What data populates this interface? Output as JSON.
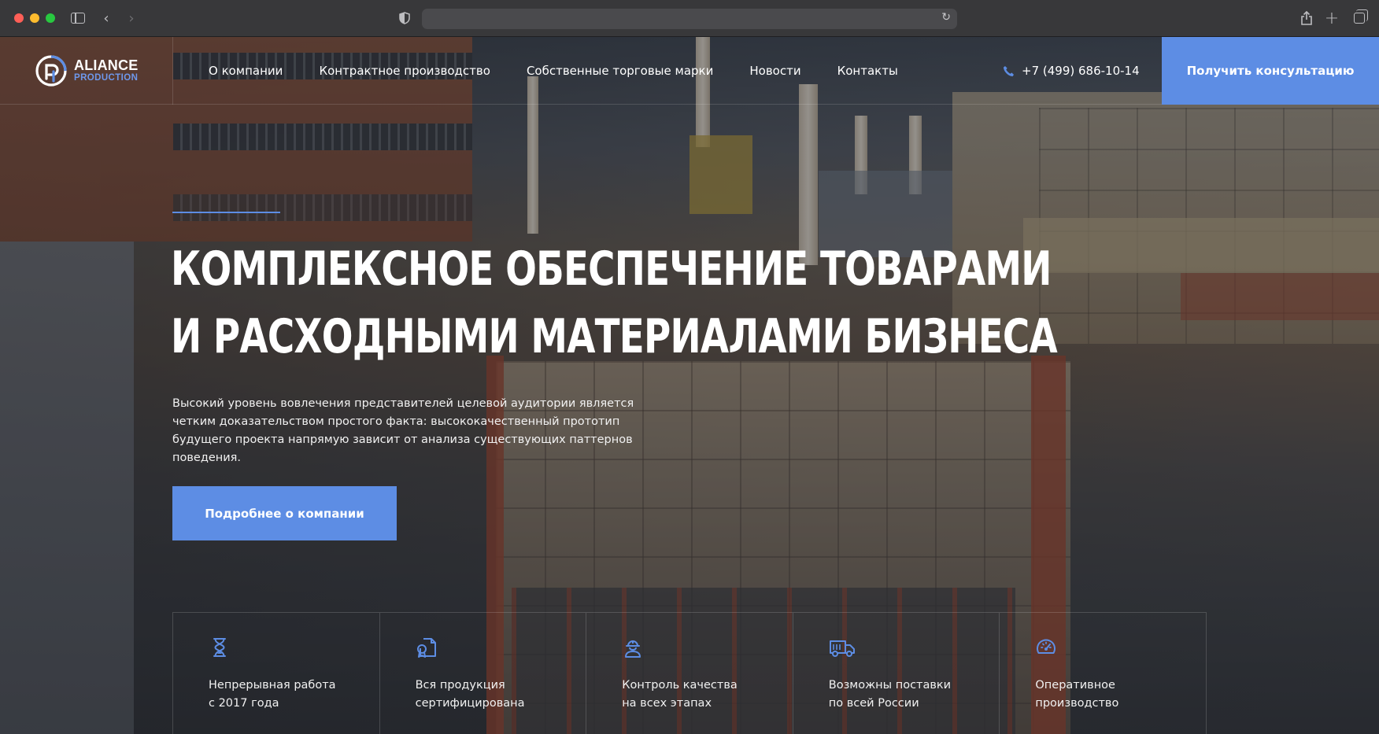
{
  "header": {
    "logo_top": "ALIANCE",
    "logo_bottom": "PRODUCTION",
    "nav": [
      {
        "label": "О компании"
      },
      {
        "label": "Контрактное производство"
      },
      {
        "label": "Собственные торговые марки"
      },
      {
        "label": "Новости"
      },
      {
        "label": "Контакты"
      }
    ],
    "phone": "+7 (499) 686-10-14",
    "cta": "Получить консультацию"
  },
  "hero": {
    "title_line1": "Комплексное обеспечение товарами",
    "title_line2": "и расходными материалами бизнеса",
    "description": "Высокий уровень вовлечения представителей целевой аудитории является четким доказательством простого факта: высококачественный прототип будущего проекта напрямую зависит от анализа существующих паттернов поведения.",
    "cta": "Подробнее о компании"
  },
  "features": [
    {
      "icon": "hourglass-icon",
      "text": "Непрерывная работа\nс 2017 года"
    },
    {
      "icon": "certificate-icon",
      "text": "Вся продукция\nсертифицирована"
    },
    {
      "icon": "worker-helmet-icon",
      "text": "Контроль качества\nна всех этапах"
    },
    {
      "icon": "truck-icon",
      "text": "Возможны поставки\nпо всей России"
    },
    {
      "icon": "speedometer-icon",
      "text": "Оперативное\nпроизводство"
    }
  ],
  "colors": {
    "accent": "#5d8de4",
    "logo_subtitle": "#6e98ec"
  }
}
